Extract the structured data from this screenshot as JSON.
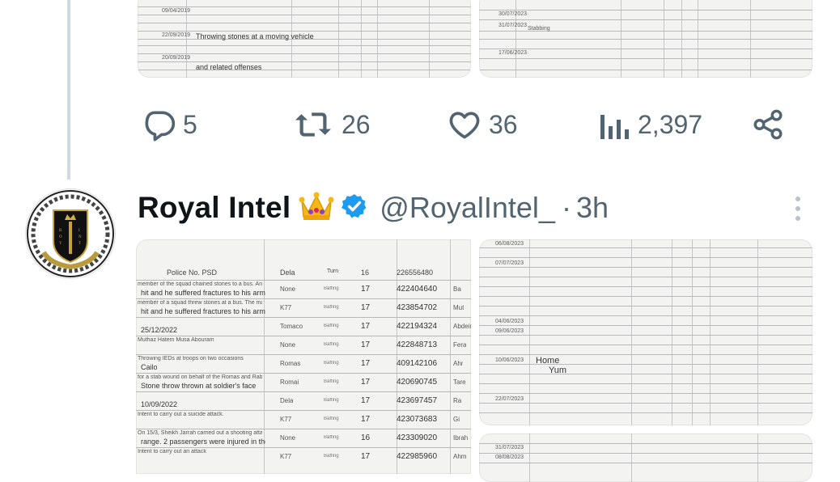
{
  "previous_tweet": {
    "actions": {
      "replies": "5",
      "reposts": "26",
      "likes": "36",
      "views": "2,397"
    }
  },
  "tweet": {
    "author_name": "Royal Intel",
    "handle": "@RoyalIntel_",
    "separator": "·",
    "time": "3h",
    "verified": true,
    "crown_emoji": "👑",
    "accent_color": "#1d9bf0",
    "document_left": {
      "header": [
        "Police No. PSD",
        "Dela",
        "Turn",
        "16",
        "226556480"
      ],
      "rows": [
        {
          "desc": "member of the squad chained stones to a bus. Another man's car was",
          "desc2": "hit and he suffered fractures to his arm",
          "status": "None",
          "type": "Baffing",
          "age": "17",
          "id": "422404640",
          "name": "Ba"
        },
        {
          "desc": "member of a squad threw stones at a bus. The man's car was",
          "desc2": "hit and he suffered fractures to his arm",
          "status": "K77",
          "type": "Baffing",
          "age": "17",
          "id": "423854702",
          "name": "Mut"
        },
        {
          "desc": "",
          "desc2": "25/12/2022",
          "status": "Tomaco",
          "type": "Baffing",
          "age": "17",
          "id": "422194324",
          "name": "Abdeir"
        },
        {
          "desc": "Muthaz Hatem Musa Abouram",
          "desc2": "",
          "status": "None",
          "type": "Baffing",
          "age": "17",
          "id": "422848713",
          "name": "Fera"
        },
        {
          "desc": "Throwing IEDs at troops on two occasions",
          "desc2": "Cailo",
          "status": "Romas",
          "type": "Baffing",
          "age": "17",
          "id": "409142106",
          "name": "Ahr"
        },
        {
          "desc": "for a stab wound on behalf of the Romas and Rabot",
          "desc2": "Stone throw thrown at soldier's face",
          "status": "Romai",
          "type": "Baffing",
          "age": "17",
          "id": "420690745",
          "name": "Tare"
        },
        {
          "desc": "",
          "desc2": "10/09/2022",
          "status": "Dela",
          "type": "Baffing",
          "age": "17",
          "id": "423697457",
          "name": "Ra"
        },
        {
          "desc": "Intent to carry out a suicide attack.",
          "desc2": "",
          "status": "K77",
          "type": "Baffing",
          "age": "17",
          "id": "423073683",
          "name": "Gi"
        },
        {
          "desc": "On 15/3, Sheikh Jarrah carried out a shooting attack inside",
          "desc2": "range. 2 passengers were injured in the attack.",
          "status": "None",
          "type": "Baffing",
          "age": "16",
          "id": "423309020",
          "name": "Ibrah"
        },
        {
          "desc": "Intent to carry out an attack",
          "desc2": "",
          "status": "K77",
          "type": "Baffing",
          "age": "17",
          "id": "422985960",
          "name": "Ahm"
        }
      ]
    },
    "document_right_labels": [
      "Home",
      "Yum"
    ]
  }
}
